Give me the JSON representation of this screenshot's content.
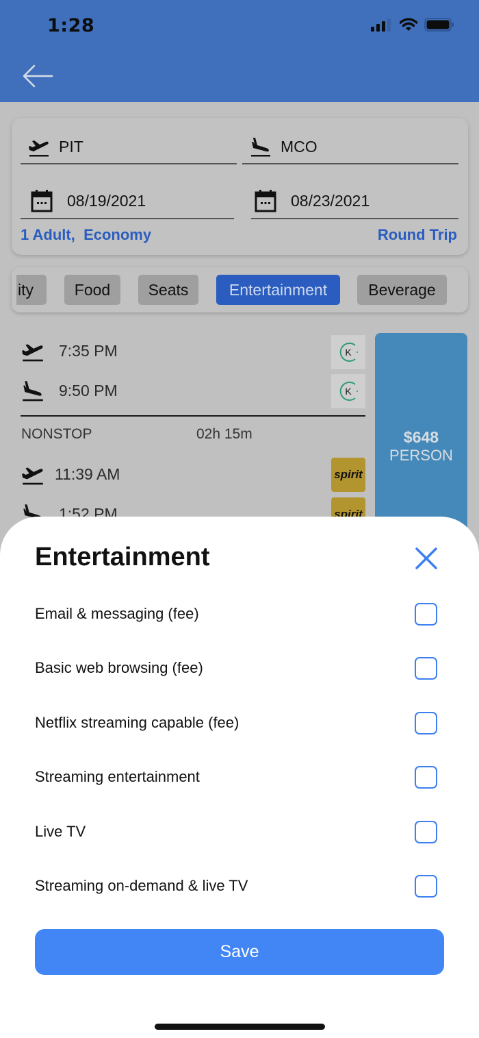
{
  "status_bar": {
    "time": "1:28"
  },
  "header": {
    "back_icon": "arrow-left-icon"
  },
  "search": {
    "origin": "PIT",
    "destination": "MCO",
    "depart_date": "08/19/2021",
    "return_date": "08/23/2021",
    "passengers": "1 Adult,  Economy",
    "trip_type": "Round Trip"
  },
  "filter_tabs": [
    {
      "label": "ity",
      "active": false
    },
    {
      "label": "Food",
      "active": false
    },
    {
      "label": "Seats",
      "active": false
    },
    {
      "label": "Entertainment",
      "active": true
    },
    {
      "label": "Beverage",
      "active": false
    }
  ],
  "flight": {
    "outbound": {
      "depart_time": "7:35 PM",
      "arrive_time": "9:50 PM",
      "airline_logo": "K"
    },
    "stops": "NONSTOP",
    "duration": "02h 15m",
    "return": {
      "depart_time": "11:39 AM",
      "arrive_time": "1:52 PM",
      "airline_logo": "spirit"
    },
    "price": "$648",
    "price_unit": "PERSON"
  },
  "sheet": {
    "title": "Entertainment",
    "options": [
      {
        "label": "Email & messaging (fee)",
        "checked": false
      },
      {
        "label": "Basic web browsing (fee)",
        "checked": false
      },
      {
        "label": "Netflix streaming capable (fee)",
        "checked": false
      },
      {
        "label": "Streaming entertainment",
        "checked": false
      },
      {
        "label": "Live TV",
        "checked": false
      },
      {
        "label": "Streaming on-demand & live TV",
        "checked": false
      }
    ],
    "save_label": "Save"
  },
  "colors": {
    "header": "#4070bc",
    "accent": "#4285f4",
    "link": "#2a5dbf",
    "price_panel": "#4489ba"
  }
}
